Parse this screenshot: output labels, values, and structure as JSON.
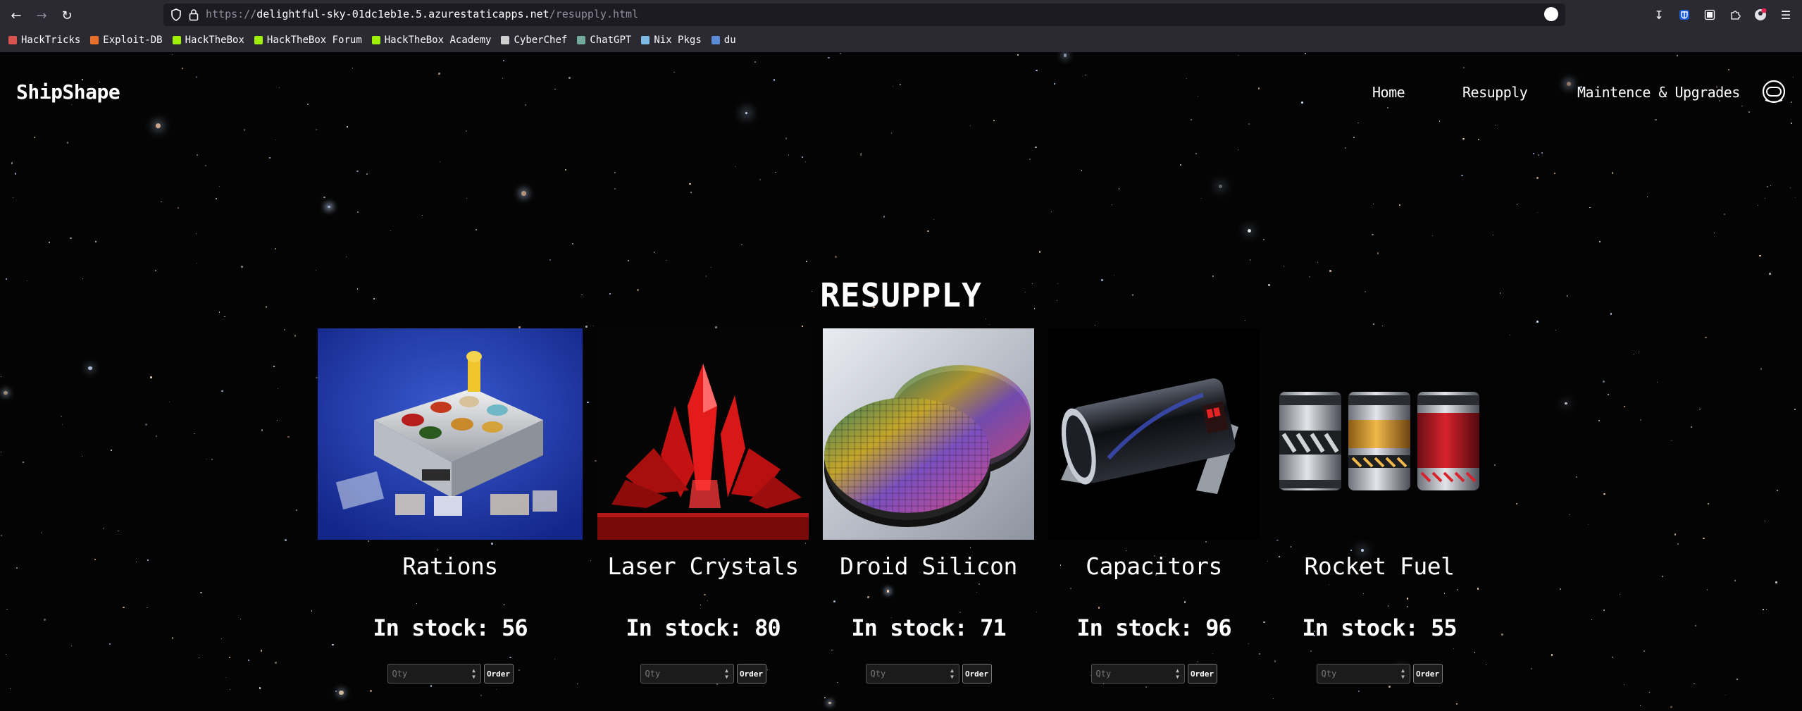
{
  "browser": {
    "url_protocol": "https://",
    "url_host": "delightful-sky-01dc1eb1e.5.azurestaticapps.net",
    "url_path": "/resupply.html",
    "bookmarks": [
      {
        "label": "HackTricks",
        "color": "#d9534f"
      },
      {
        "label": "Exploit-DB",
        "color": "#e8702a"
      },
      {
        "label": "HackTheBox",
        "color": "#9fef00"
      },
      {
        "label": "HackTheBox Forum",
        "color": "#9fef00"
      },
      {
        "label": "HackTheBox Academy",
        "color": "#9fef00"
      },
      {
        "label": "CyberChef",
        "color": "#cfcfcf"
      },
      {
        "label": "ChatGPT",
        "color": "#74aa9c"
      },
      {
        "label": "Nix Pkgs",
        "color": "#7ebae4"
      },
      {
        "label": "du",
        "color": "#5b8ad6"
      }
    ]
  },
  "site": {
    "brand": "ShipShape",
    "nav": [
      {
        "label": "Home"
      },
      {
        "label": "Resupply"
      },
      {
        "label": "Maintence & Upgrades"
      }
    ],
    "page_title": "RESUPPLY",
    "qty_placeholder": "Qty",
    "order_label": "Order",
    "products": [
      {
        "name": "Rations",
        "stock_text": "In stock: 56"
      },
      {
        "name": "Laser Crystals",
        "stock_text": "In stock: 80"
      },
      {
        "name": "Droid Silicon",
        "stock_text": "In stock: 71"
      },
      {
        "name": "Capacitors",
        "stock_text": "In stock: 96"
      },
      {
        "name": "Rocket Fuel",
        "stock_text": "In stock: 55"
      }
    ]
  },
  "colors": {
    "chrome_bg": "#2b2a33",
    "urlbar_bg": "#1c1b22",
    "page_bg": "#040404"
  }
}
